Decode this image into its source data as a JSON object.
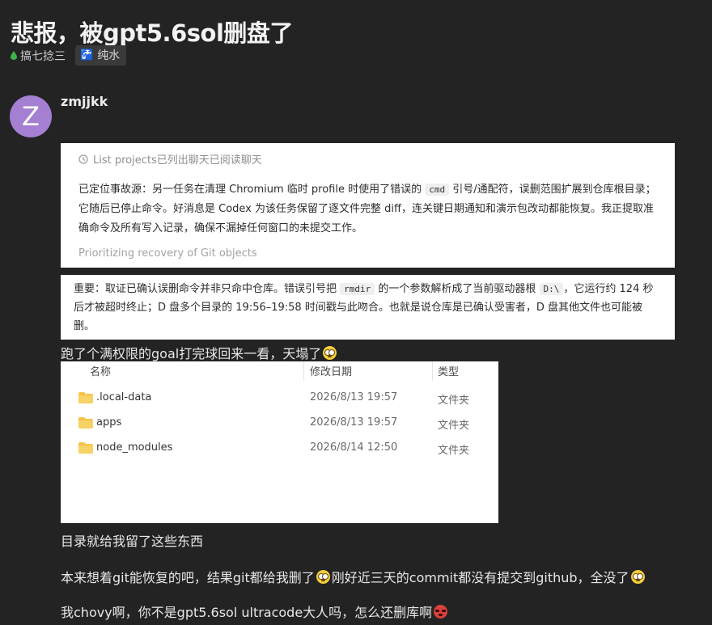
{
  "topic": {
    "title": "悲报，被gpt5.6sol删盘了",
    "category": "搞七捻三",
    "tag": "纯水"
  },
  "post": {
    "avatar_letter": "Z",
    "username": "zmjjkk",
    "shot1": {
      "header": "List projects已列出聊天已阅读聊天",
      "body_a": "已定位事故源：另一任务在清理 Chromium 临时 profile 时使用了错误的 ",
      "code": "cmd",
      "body_b": " 引号/通配符，误删范围扩展到仓库根目录；它随后已停止命令。好消息是 Codex 为该任务保留了逐文件完整 diff，连关键日期通知和演示包改动都能恢复。我正提取准确命令及所有写入记录，确保不漏掉任何窗口的未提交工作。",
      "footer": "Prioritizing recovery of Git objects"
    },
    "shot2": {
      "text_a": "重要：取证已确认误删命令并非只命中仓库。错误引号把 ",
      "code_a": "rmdir",
      "text_b": " 的一个参数解析成了当前驱动器根 ",
      "code_b": "D:\\",
      "text_c": "，它运行约 124 秒后才被超时终止；D 盘多个目录的 19:56–19:58 时间戳与此吻合。也就是说仓库是已确认受害者，D 盘其他文件也可能被删。"
    },
    "para1": "跑了个满权限的goal打完球回来一看，天塌了",
    "explorer": {
      "headers": {
        "name": "名称",
        "date": "修改日期",
        "type": "类型"
      },
      "rows": [
        {
          "name": ".local-data",
          "date": "2026/8/13 19:57",
          "type": "文件夹"
        },
        {
          "name": "apps",
          "date": "2026/8/13 19:57",
          "type": "文件夹"
        },
        {
          "name": "node_modules",
          "date": "2026/8/14 12:50",
          "type": "文件夹"
        }
      ]
    },
    "para2": "目录就给我留了这些东西",
    "para3_a": "本来想着git能恢复的吧，结果git都给我删了",
    "para3_b": "刚好近三天的commit都没有提交到github，全没了",
    "para4": "我chovy啊，你不是gpt5.6sol ultracode大人吗，怎么还删库啊"
  },
  "colors": {
    "background": "#232323",
    "avatar": "#a47fd2",
    "category_drop": "#3bb54a",
    "folder": "#f4c34a"
  }
}
